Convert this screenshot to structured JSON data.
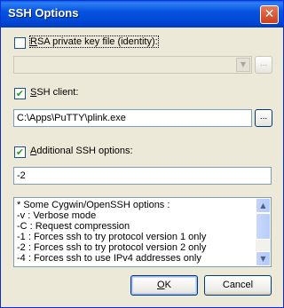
{
  "window": {
    "title": "SSH Options",
    "close_glyph": "✕"
  },
  "rsa": {
    "checked": false,
    "label_mnemonic": "R",
    "label_rest": "SA private key file (identity):",
    "value": "",
    "browse_label": "..."
  },
  "ssh_client": {
    "checked": true,
    "check_glyph": "✔",
    "label_mnemonic": "S",
    "label_rest": "SH client:",
    "value": "C:\\Apps\\PuTTY\\plink.exe",
    "browse_label": "..."
  },
  "additional": {
    "checked": true,
    "check_glyph": "✔",
    "label_mnemonic": "A",
    "label_rest": "dditional SSH options:",
    "value": "-2"
  },
  "help_text": {
    "lines": [
      "* Some Cygwin/OpenSSH options :",
      "-v : Verbose mode",
      "-C : Request compression",
      "-1 : Forces ssh to try protocol version 1 only",
      "-2 : Forces ssh to try protocol version 2 only",
      "-4 : Forces ssh to use IPv4 addresses only"
    ]
  },
  "buttons": {
    "ok_mnemonic": "O",
    "ok_rest": "K",
    "cancel": "Cancel"
  },
  "icons": {
    "dropdown": "▼",
    "scroll_up": "▲",
    "scroll_down": "▼"
  }
}
